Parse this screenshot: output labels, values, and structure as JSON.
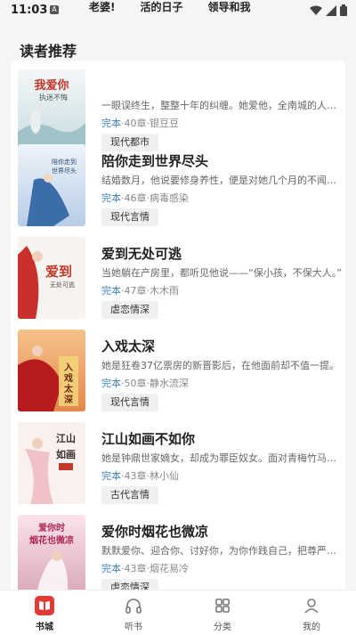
{
  "statusbar": {
    "time": "11:03",
    "notif_icon": "A",
    "tabs": [
      "老婆!",
      "活的日子",
      "领导和我"
    ]
  },
  "section": {
    "title": "读者推荐"
  },
  "books": [
    {
      "title": "",
      "cover_text": "我爱你 执迷不悔",
      "desc": "一眼误终生，整整十年的纠缠。她爱他，全南城的人都知道",
      "status": "完本",
      "meta": "·40章·银豆豆",
      "tag": "现代都市"
    },
    {
      "title": "陪你走到世界尽头",
      "cover_text": "陪你走到世界尽头",
      "desc": "结婚数月，他说要修身养性，便是对她几个月的不闻不问",
      "status": "完本",
      "meta": "·46章·病毒感染",
      "tag": "现代言情"
    },
    {
      "title": "爱到无处可逃",
      "cover_text": "爱到无处可逃",
      "desc": "当她躺在产房里，都听见他说——“保小孩，不保大人。”",
      "status": "完本",
      "meta": "·47章·木木雨",
      "tag": "虐恋情深"
    },
    {
      "title": "入戏太深",
      "cover_text": "入戏太深",
      "desc": "她是狂卷37亿票房的新晋影后，在他面前却不值一提。",
      "status": "完本",
      "meta": "·50章·静水流深",
      "tag": "现代言情"
    },
    {
      "title": "江山如画不如你",
      "cover_text": "江山如画",
      "desc": "她是钟鼎世家嫡女，却成为罪臣奴女。面对青梅竹马的少年",
      "status": "完本",
      "meta": "·43章·林小仙",
      "tag": "古代言情"
    },
    {
      "title": "爱你时烟花也微凉",
      "cover_text": "爱你时烟花也微凉",
      "desc": "默默爱你、迎合你、讨好你，为你作践自己，把尊严踩进泥里",
      "status": "完本",
      "meta": "·43章·烟花易冷",
      "tag": "虐恋情深"
    }
  ],
  "tabbar": [
    {
      "label": "书城",
      "icon": "book-icon"
    },
    {
      "label": "听书",
      "icon": "headphones-icon"
    },
    {
      "label": "分类",
      "icon": "grid-icon"
    },
    {
      "label": "我的",
      "icon": "user-icon"
    }
  ],
  "colors": {
    "accent": "#e53935",
    "status": "#3b82c4"
  }
}
